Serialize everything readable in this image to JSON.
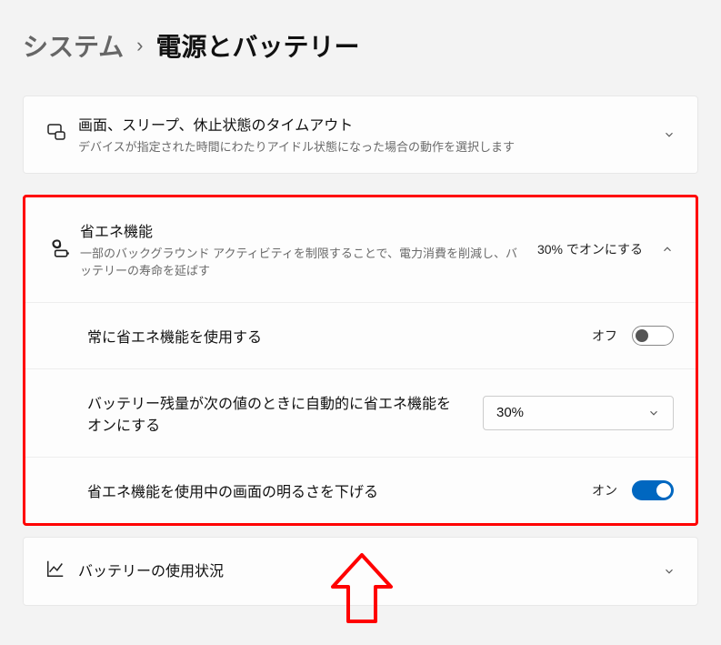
{
  "breadcrumb": {
    "parent": "システム",
    "separator": "›",
    "current": "電源とバッテリー"
  },
  "screenTimeouts": {
    "title": "画面、スリープ、休止状態のタイムアウト",
    "desc": "デバイスが指定された時間にわたりアイドル状態になった場合の動作を選択します"
  },
  "energySaver": {
    "title": "省エネ機能",
    "desc": "一部のバックグラウンド アクティビティを制限することで、電力消費を削減し、バッテリーの寿命を延ばす",
    "trailing": "30% でオンにする",
    "sub": [
      {
        "label": "常に省エネ機能を使用する",
        "state": "オフ",
        "on": false
      },
      {
        "label": "バッテリー残量が次の値のときに自動的に省エネ機能をオンにする",
        "value": "30%"
      },
      {
        "label": "省エネ機能を使用中の画面の明るさを下げる",
        "state": "オン",
        "on": true
      }
    ]
  },
  "batteryUsage": {
    "title": "バッテリーの使用状況"
  }
}
